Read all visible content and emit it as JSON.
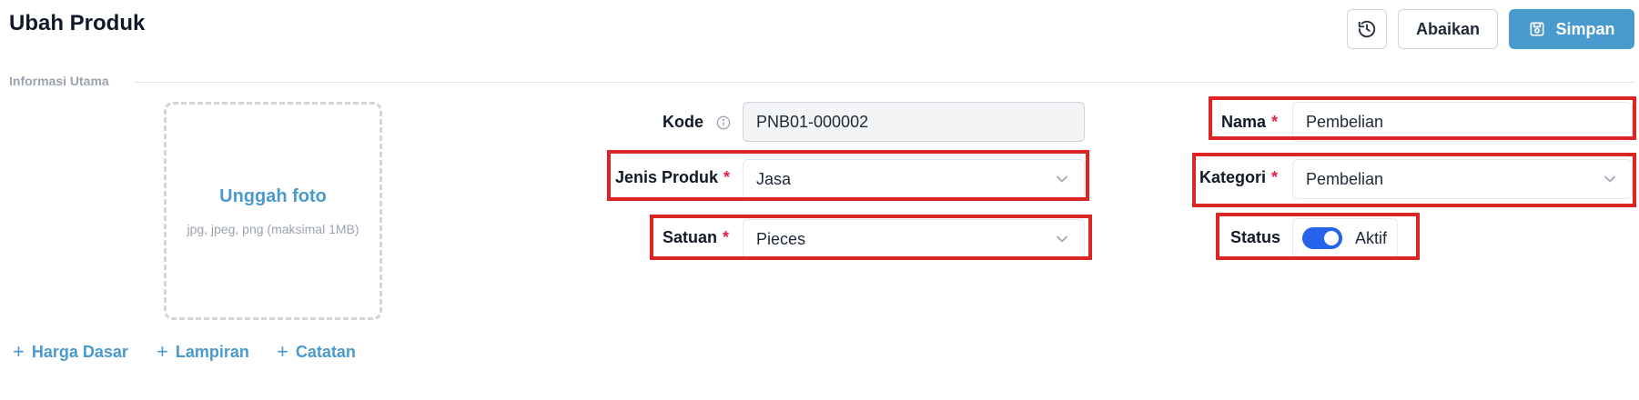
{
  "header": {
    "title": "Ubah Produk",
    "history_icon": "history-icon",
    "cancel_label": "Abaikan",
    "save_label": "Simpan",
    "save_icon": "save-icon"
  },
  "section": {
    "label": "Informasi Utama"
  },
  "upload": {
    "title": "Unggah foto",
    "hint": "jpg, jpeg, png (maksimal 1MB)"
  },
  "fields": {
    "kode": {
      "label": "Kode",
      "value": "PNB01-000002",
      "icon": "info-icon"
    },
    "jenis_produk": {
      "label": "Jenis Produk",
      "required": "*",
      "value": "Jasa"
    },
    "satuan": {
      "label": "Satuan",
      "required": "*",
      "value": "Pieces"
    },
    "nama": {
      "label": "Nama",
      "required": "*",
      "value": "Pembelian"
    },
    "kategori": {
      "label": "Kategori",
      "required": "*",
      "value": "Pembelian"
    },
    "status": {
      "label": "Status",
      "value": "Aktif",
      "enabled": true
    }
  },
  "links": {
    "harga_dasar": "Harga Dasar",
    "lampiran": "Lampiran",
    "catatan": "Catatan",
    "plus": "+"
  },
  "colors": {
    "accent": "#4a9ad0",
    "toggle_on": "#2563eb",
    "highlight": "#dc2626",
    "required": "#e11d48"
  }
}
